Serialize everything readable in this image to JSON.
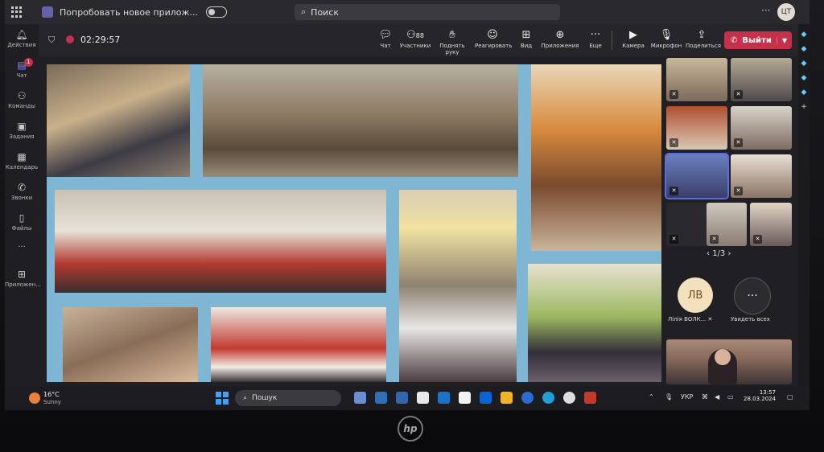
{
  "window": {
    "search_placeholder": "Поиск",
    "try_new": "Попробовать новое прилож...",
    "more": "···",
    "user_initials": "ЦТ"
  },
  "rail": [
    {
      "label": "Действия",
      "icon": "bell-icon"
    },
    {
      "label": "Чат",
      "icon": "chat-icon",
      "badge": "1"
    },
    {
      "label": "Команды",
      "icon": "teams-icon"
    },
    {
      "label": "Задания",
      "icon": "assignments-icon"
    },
    {
      "label": "Календарь",
      "icon": "calendar-icon"
    },
    {
      "label": "Звонки",
      "icon": "phone-icon"
    },
    {
      "label": "Файлы",
      "icon": "file-icon"
    },
    {
      "label": "···",
      "icon": "more-icon"
    },
    {
      "label": "Приложен...",
      "icon": "apps-icon"
    }
  ],
  "meeting": {
    "timer": "02:29:57",
    "toolbar": [
      {
        "label": "Чат",
        "icon": "chat-icon"
      },
      {
        "label": "Участники",
        "icon": "people-icon",
        "count": "88"
      },
      {
        "label": "Поднять руку",
        "icon": "hand-icon"
      },
      {
        "label": "Реагировать",
        "icon": "smile-icon"
      },
      {
        "label": "Вид",
        "icon": "view-icon"
      },
      {
        "label": "Приложения",
        "icon": "plus-icon"
      },
      {
        "label": "Еще",
        "icon": "more-icon"
      },
      {
        "label": "Камера",
        "icon": "camera-icon"
      },
      {
        "label": "Микрофон",
        "icon": "mic-icon"
      },
      {
        "label": "Поделиться",
        "icon": "share-icon"
      }
    ],
    "leave_label": "Выйти"
  },
  "participants": {
    "pager": "1/3",
    "named_initials": "ЛВ",
    "named": "Лілія ВОЛК...",
    "see_all": "Увидеть всех",
    "see_all_icon": "···"
  },
  "taskbar": {
    "temp": "16°C",
    "weather": "Sunny",
    "search": "Пошук",
    "lang": "УКР",
    "time": "13:57",
    "date": "28.03.2024"
  },
  "colors": {
    "accent": "#6264a7",
    "leave": "#c4314b",
    "shared_bg": "#7fb6d3",
    "windows_blue": "#3ea0ff"
  }
}
